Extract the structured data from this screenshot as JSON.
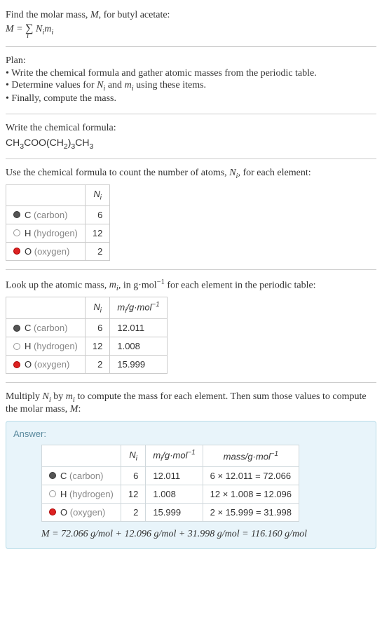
{
  "intro": {
    "line1_pre": "Find the molar mass, ",
    "line1_var": "M",
    "line1_post": ", for butyl acetate:",
    "formula_lhs": "M",
    "formula_eq": " = ",
    "formula_sum": "∑",
    "formula_sub": "i",
    "formula_rhs_pre": " N",
    "formula_rhs_sub1": "i",
    "formula_rhs_mid": "m",
    "formula_rhs_sub2": "i"
  },
  "plan": {
    "title": "Plan:",
    "items": [
      "• Write the chemical formula and gather atomic masses from the periodic table.",
      "• Determine values for Nᵢ and mᵢ using these items.",
      "• Finally, compute the mass."
    ]
  },
  "chem": {
    "title": "Write the chemical formula:",
    "formula_parts": [
      "CH",
      "3",
      "COO(CH",
      "2",
      ")",
      "3",
      "CH",
      "3"
    ]
  },
  "count": {
    "title_pre": "Use the chemical formula to count the number of atoms, ",
    "title_var": "N",
    "title_sub": "i",
    "title_post": ", for each element:",
    "header_n": "N",
    "header_n_sub": "i",
    "rows": [
      {
        "dot": "carbon",
        "sym": "C",
        "name": "(carbon)",
        "n": "6"
      },
      {
        "dot": "hydrogen",
        "sym": "H",
        "name": "(hydrogen)",
        "n": "12"
      },
      {
        "dot": "oxygen",
        "sym": "O",
        "name": "(oxygen)",
        "n": "2"
      }
    ]
  },
  "lookup": {
    "title_pre": "Look up the atomic mass, ",
    "title_var": "m",
    "title_sub": "i",
    "title_mid": ", in g·mol",
    "title_sup": "−1",
    "title_post": " for each element in the periodic table:",
    "header_n": "N",
    "header_n_sub": "i",
    "header_m_pre": "m",
    "header_m_sub": "i",
    "header_m_mid": "/g·mol",
    "header_m_sup": "−1",
    "rows": [
      {
        "dot": "carbon",
        "sym": "C",
        "name": "(carbon)",
        "n": "6",
        "m": "12.011"
      },
      {
        "dot": "hydrogen",
        "sym": "H",
        "name": "(hydrogen)",
        "n": "12",
        "m": "1.008"
      },
      {
        "dot": "oxygen",
        "sym": "O",
        "name": "(oxygen)",
        "n": "2",
        "m": "15.999"
      }
    ]
  },
  "multiply": {
    "text_pre": "Multiply ",
    "text_n": "N",
    "text_n_sub": "i",
    "text_mid1": " by ",
    "text_m": "m",
    "text_m_sub": "i",
    "text_mid2": " to compute the mass for each element. Then sum those values to compute the molar mass, ",
    "text_mvar": "M",
    "text_post": ":"
  },
  "answer": {
    "label": "Answer:",
    "header_n": "N",
    "header_n_sub": "i",
    "header_m_pre": "m",
    "header_m_sub": "i",
    "header_m_mid": "/g·mol",
    "header_m_sup": "−1",
    "header_mass_pre": "mass/g·mol",
    "header_mass_sup": "−1",
    "rows": [
      {
        "dot": "carbon",
        "sym": "C",
        "name": "(carbon)",
        "n": "6",
        "m": "12.011",
        "mass": "6 × 12.011 = 72.066"
      },
      {
        "dot": "hydrogen",
        "sym": "H",
        "name": "(hydrogen)",
        "n": "12",
        "m": "1.008",
        "mass": "12 × 1.008 = 12.096"
      },
      {
        "dot": "oxygen",
        "sym": "O",
        "name": "(oxygen)",
        "n": "2",
        "m": "15.999",
        "mass": "2 × 15.999 = 31.998"
      }
    ],
    "result_var": "M",
    "result_text": " = 72.066 g/mol + 12.096 g/mol + 31.998 g/mol = 116.160 g/mol"
  }
}
